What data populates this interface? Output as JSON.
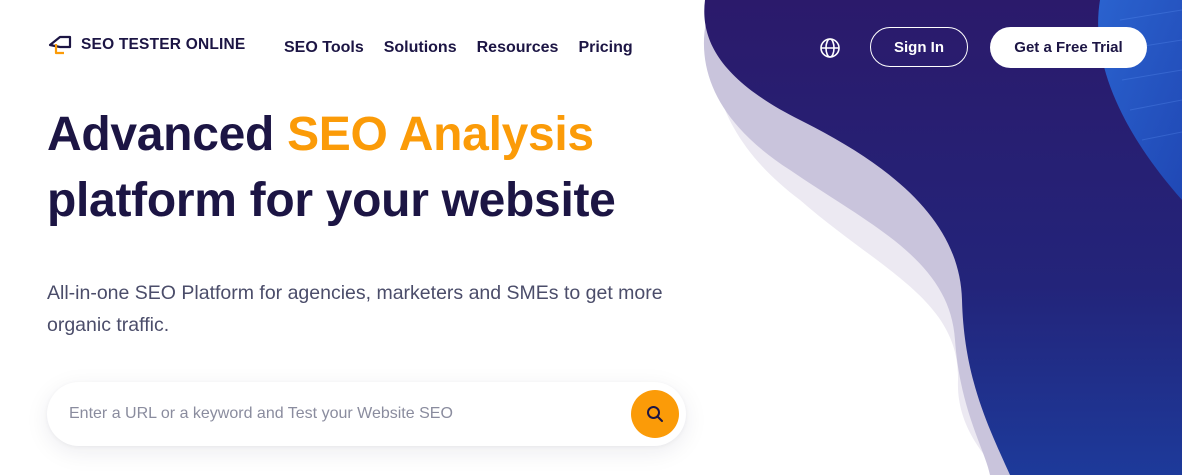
{
  "brand": {
    "name": "SEO TESTER ONLINE"
  },
  "nav": {
    "items": [
      {
        "label": "SEO Tools"
      },
      {
        "label": "Solutions"
      },
      {
        "label": "Resources"
      },
      {
        "label": "Pricing"
      }
    ],
    "language_icon": "globe-icon",
    "signin_label": "Sign In",
    "trial_label": "Get a Free Trial"
  },
  "hero": {
    "title_part1": "Advanced",
    "title_accent": "SEO Analysis",
    "title_part2": "platform for your website",
    "subtitle": "All-in-one SEO Platform for agencies, marketers and SMEs to get more organic traffic."
  },
  "search": {
    "placeholder": "Enter a URL or a keyword and Test your Website SEO",
    "value": "",
    "button_icon": "search-icon"
  },
  "colors": {
    "navy": "#1c1544",
    "accent": "#fb9b08",
    "purple": "#2b1a6b",
    "blue": "#1d3a9a"
  }
}
